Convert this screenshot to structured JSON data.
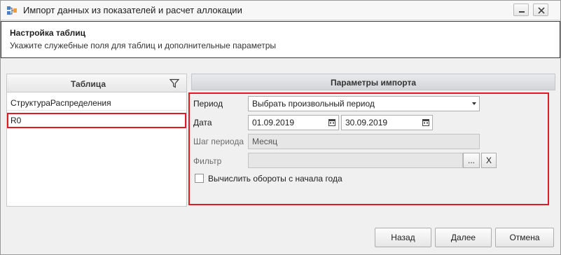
{
  "window": {
    "title": "Импорт данных из показателей и расчет аллокации"
  },
  "header": {
    "title": "Настройка таблиц",
    "subtitle": "Укажите служебные поля для таблиц и дополнительные параметры"
  },
  "tables": {
    "column_header": "Таблица",
    "rows": [
      "СтруктураРаспределения",
      "R0"
    ],
    "selected_index": 1
  },
  "params": {
    "header": "Параметры импорта",
    "period_label": "Период",
    "period_value": "Выбрать произвольный период",
    "date_label": "Дата",
    "date_from": "01.09.2019",
    "date_to": "30.09.2019",
    "step_label": "Шаг периода",
    "step_value": "Месяц",
    "filter_label": "Фильтр",
    "filter_value": "",
    "filter_browse": "...",
    "filter_clear": "X",
    "turnover_label": "Вычислить обороты с начала года",
    "turnover_checked": false
  },
  "buttons": {
    "back": "Назад",
    "next": "Далее",
    "cancel": "Отмена"
  },
  "colors": {
    "highlight_border": "#e01b24",
    "panel_header": "#d3d5d9"
  }
}
